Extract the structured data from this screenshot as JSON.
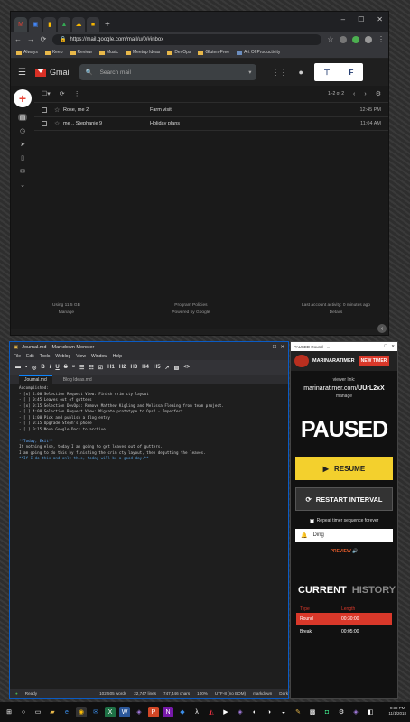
{
  "chrome": {
    "url": "https://mail.google.com/mail/u/0/#inbox",
    "bookmarks": [
      "Always",
      "Keep",
      "Review",
      "Music",
      "Meetup Ideas",
      "DevOps",
      "Gluten-Free",
      "Art Of Productivity"
    ],
    "window_controls": [
      "–",
      "☐",
      "✕"
    ]
  },
  "gmail": {
    "brand": "Gmail",
    "search_placeholder": "Search mail",
    "pagination": "1–2 of 2",
    "emails": [
      {
        "sender": "Rose, me 2",
        "subject": "Farm visit",
        "time": "12:45 PM"
      },
      {
        "sender": "me .. Stephanie 9",
        "subject": "Holiday plans",
        "time": "11:04 AM"
      }
    ],
    "footer": {
      "storage": "Using 11.5 GB",
      "manage": "Manage",
      "policies": "Program Policies",
      "powered": "Powered by Google",
      "activity": "Last account activity: 0 minutes ago",
      "details": "Details"
    }
  },
  "markdown_monster": {
    "title": "Journal.md – Markdown Monster",
    "menu": [
      "File",
      "Edit",
      "Tools",
      "Weblog",
      "View",
      "Window",
      "Help"
    ],
    "toolbar": [
      "B",
      "I",
      "U",
      "S",
      "H1",
      "H2",
      "H3",
      "H4",
      "H5"
    ],
    "tabs": [
      "Journal.md",
      "Blog Ideas.md"
    ],
    "lines": [
      "Accomplished:",
      "- [x] 2:00 Selection Request View: Finish crim cty layout",
      "- [ ] 0:45 Leaves out of gutters",
      "- [x] 0:15 Selection DevOps: Remove Matthew Kigling and Melissa Fleming from team project.",
      "- [ ] 4:00 Selection Request View: Migrate prototype to Ops2 - Imperfect",
      "- [ ] 1:00 Pick and publish a blog entry",
      "- [ ] 0:15 Upgrade Steph's phone",
      "- [ ] 0:15 Move Google Docs to archive",
      "",
      "**Today, Exit**",
      "If nothing else, today I am going to get leaves out of gutters.",
      "I am going to do this by finishing the crim cty layout, then degutting the leaves.",
      "**If I do this and only this, today will be a good day.**"
    ],
    "status": {
      "ready": "Ready",
      "words": "102,505 words",
      "lines": "22,747 lines",
      "chars": "747,446 chars",
      "zoom": "100%",
      "encoding": "UTF-8 (no BOM)",
      "mode": "markdown",
      "theme": "Dark"
    }
  },
  "timer": {
    "window_title": "PAUSED Round - ...",
    "brand": "MARINARATIMER",
    "new_timer": "NEW TIMER",
    "viewer_label": "viewer link:",
    "viewer_link_prefix": "marinaratimer.com/",
    "viewer_link_code": "UUrL2xX",
    "manage": "manage",
    "state": "PAUSED",
    "resume": "RESUME",
    "restart": "RESTART INTERVAL",
    "repeat": "Repeat timer sequence forever",
    "sound": "Ding",
    "preview": "PREVIEW",
    "tab_current": "CURRENT",
    "tab_history": "HISTORY",
    "table_headers": [
      "Type",
      "Length"
    ],
    "rows": [
      {
        "type": "Round",
        "length": "00:30:00"
      },
      {
        "type": "Break",
        "length": "00:05:00"
      }
    ]
  },
  "taskbar": {
    "time": "9:39 PM",
    "date": "11/1/2018"
  }
}
